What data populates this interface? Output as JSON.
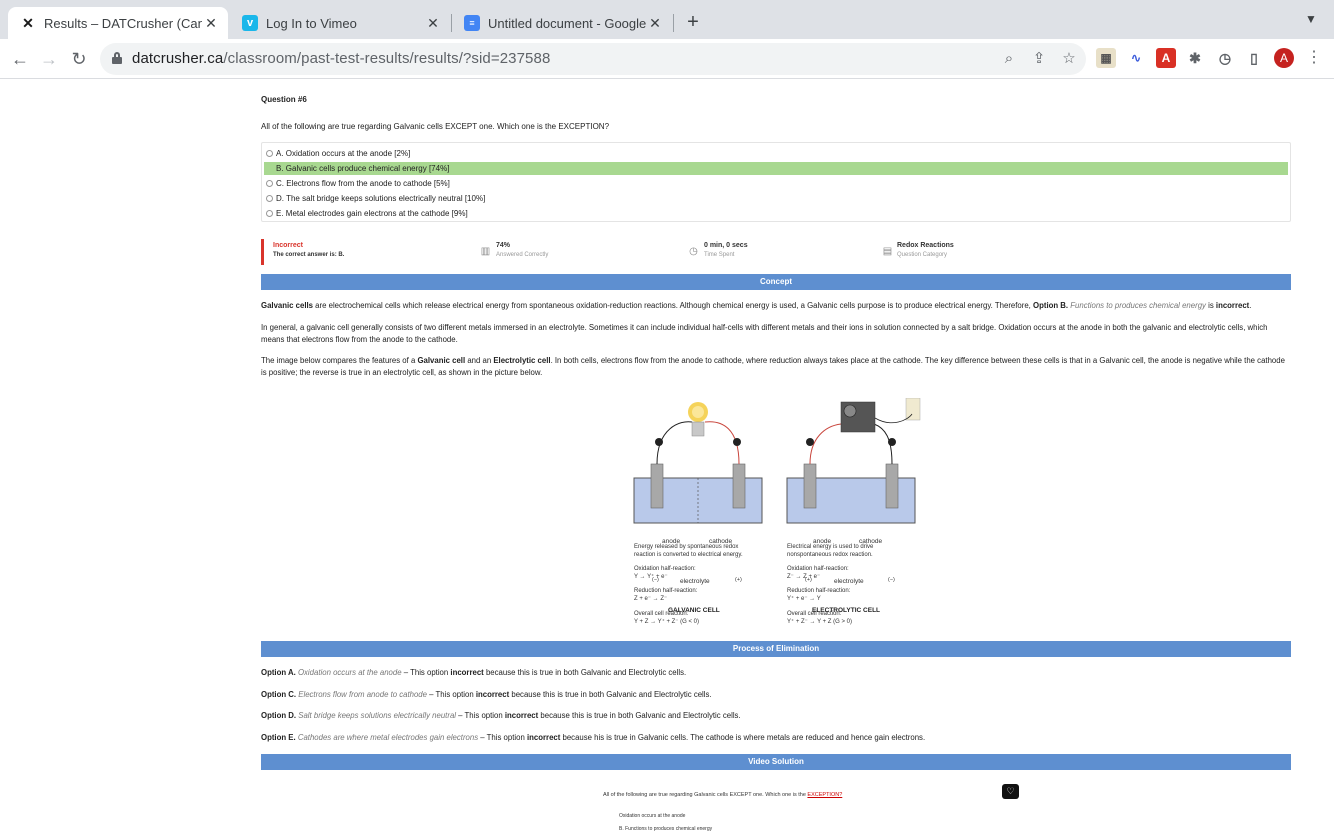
{
  "browser": {
    "tabs": [
      {
        "title": "Results – DATCrusher (Canadia",
        "favicon": "datcrusher-x-icon",
        "active": true
      },
      {
        "title": "Log In to Vimeo",
        "favicon": "vimeo-icon",
        "active": false
      },
      {
        "title": "Untitled document - Google Do",
        "favicon": "google-docs-icon",
        "active": false
      }
    ],
    "new_tab": "+",
    "url_host": "datcrusher.ca",
    "url_path": "/classroom/past-test-results/results/?sid=237588",
    "avatar_letter": "A",
    "ext_pdf": "A"
  },
  "question": {
    "number": "Question #6",
    "text": "All of the following are true regarding Galvanic cells EXCEPT one. Which one is the EXCEPTION?",
    "options": [
      {
        "label": "A. Oxidation occurs at the anode [2%]",
        "correct": false
      },
      {
        "label": "B. Galvanic cells produce chemical energy [74%]",
        "correct": true
      },
      {
        "label": "C. Electrons flow from the anode to cathode [5%]",
        "correct": false
      },
      {
        "label": "D. The salt bridge keeps solutions electrically neutral [10%]",
        "correct": false
      },
      {
        "label": "E. Metal electrodes gain electrons at the cathode [9%]",
        "correct": false
      }
    ]
  },
  "stats": {
    "result": "Incorrect",
    "result_note": "The correct answer is: B.",
    "percent": "74%",
    "percent_label": "Answered Correctly",
    "time": "0 min, 0 secs",
    "time_label": "Time Spent",
    "category": "Redox Reactions",
    "category_label": "Question Category"
  },
  "sections": {
    "concept": "Concept",
    "elimination": "Process of Elimination",
    "video": "Video Solution"
  },
  "concept": {
    "p1_b1": "Galvanic cells",
    "p1_t1": " are electrochemical cells which release electrical energy from spontaneous oxidation-reduction reactions. Although chemical energy is used, a Galvanic cells purpose is to produce electrical energy. Therefore, ",
    "p1_b2": "Option B.",
    "p1_i1": " Functions to produces chemical energy",
    "p1_t2": " is ",
    "p1_b3": "incorrect",
    "p1_t3": ".",
    "p2": "In general, a galvanic cell generally consists of two different metals immersed in an electrolyte. Sometimes it can include individual half-cells with different metals and their ions in solution connected by a salt bridge. Oxidation occurs at the anode in both the galvanic and electrolytic cells, which means that electrons flow from the anode to the cathode.",
    "p3_t1": "The image below compares the features of a ",
    "p3_b1": "Galvanic cell",
    "p3_t2": " and an ",
    "p3_b2": "Electrolytic cell",
    "p3_t3": ". In both cells,  electrons flow from the anode to cathode, where reduction always takes place at the cathode. The key difference between these cells is that in a Galvanic cell, the anode is negative while the cathode is positive; the reverse is true in an electrolytic cell, as shown in the picture below."
  },
  "diagram": {
    "galvanic": {
      "title": "GALVANIC CELL",
      "anode": "anode",
      "cathode": "cathode",
      "electrolyte": "electrolyte",
      "left_sign": "(−)",
      "right_sign": "(+)",
      "desc": "Energy released by spontaneous redox\nreaction is converted to electrical energy.",
      "ox_label": "Oxidation half-reaction:",
      "ox": "Y → Y⁺ + e⁻",
      "red_label": "Reduction half-reaction:",
      "red": "Z + e⁻ → Z⁻",
      "overall_label": "Overall cell reaction:",
      "overall": "Y + Z → Y⁺ + Z⁻ (G < 0)"
    },
    "electrolytic": {
      "title": "ELECTROLYTIC CELL",
      "anode": "anode",
      "cathode": "cathode",
      "electrolyte": "electrolyte",
      "left_sign": "(+)",
      "right_sign": "(−)",
      "desc": "Electrical energy is used to drive\nnonspontaneous redox reaction.",
      "ox_label": "Oxidation half-reaction:",
      "ox": "Z⁻ → Z + e⁻",
      "red_label": "Reduction half-reaction:",
      "red": "Y⁺ + e⁻ → Y",
      "overall_label": "Overall cell reaction:",
      "overall": "Y⁺ + Z⁻ → Y + Z (G > 0)"
    }
  },
  "elimination": [
    {
      "opt": "Option A.",
      "desc": " Oxidation occurs at the anode",
      "t1": " – This option ",
      "b": "incorrect",
      "t2": " because this is true in both Galvanic and Electrolytic cells."
    },
    {
      "opt": "Option C.",
      "desc": " Electrons flow from anode to cathode",
      "t1": " – This option ",
      "b": "incorrect",
      "t2": " because this is true in both Galvanic and Electrolytic cells."
    },
    {
      "opt": "Option D.",
      "desc": " Salt bridge keeps solutions electrically neutral",
      "t1": " – This option ",
      "b": "incorrect",
      "t2": " because this is true in both Galvanic and Electrolytic cells."
    },
    {
      "opt": "Option E.",
      "desc": " Cathodes are where metal electrodes gain electrons",
      "t1": " – This option ",
      "b": "incorrect",
      "t2": " because his is true in Galvanic cells. The cathode is where metals are reduced and hence gain electrons."
    }
  ],
  "video": {
    "q_text": "All of the following are true regarding Galvanic cells EXCEPT one. Which one is the ",
    "q_u": "EXCEPTION?",
    "opt1": "Oxidation occurs at the anode",
    "opt2": "B. Functions to produces chemical energy"
  }
}
